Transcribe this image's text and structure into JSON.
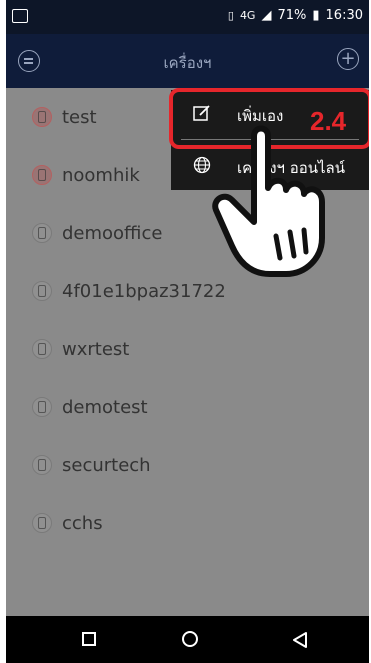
{
  "status_bar": {
    "battery_percent": "71%",
    "time": "16:30",
    "network_label": "4G"
  },
  "app_bar": {
    "title": "เครื่องฯ"
  },
  "devices": [
    {
      "name": "test",
      "status": "offline"
    },
    {
      "name": "noomhik",
      "status": "offline"
    },
    {
      "name": "demooffice",
      "status": "unknown"
    },
    {
      "name": "4f01e1bpaz31722",
      "status": "unknown"
    },
    {
      "name": "wxrtest",
      "status": "unknown"
    },
    {
      "name": "demotest",
      "status": "unknown"
    },
    {
      "name": "securtech",
      "status": "unknown"
    },
    {
      "name": "cchs",
      "status": "unknown"
    }
  ],
  "popup_menu": {
    "items": [
      {
        "label": "เพิ่มเอง",
        "icon": "edit-icon"
      },
      {
        "label": "เครื่องฯ ออนไลน์",
        "icon": "globe-icon"
      }
    ]
  },
  "annotation": {
    "step_label": "2.4",
    "highlight_color": "#e6262b"
  },
  "nav_bar": {
    "buttons": [
      "recents",
      "home",
      "back"
    ]
  }
}
